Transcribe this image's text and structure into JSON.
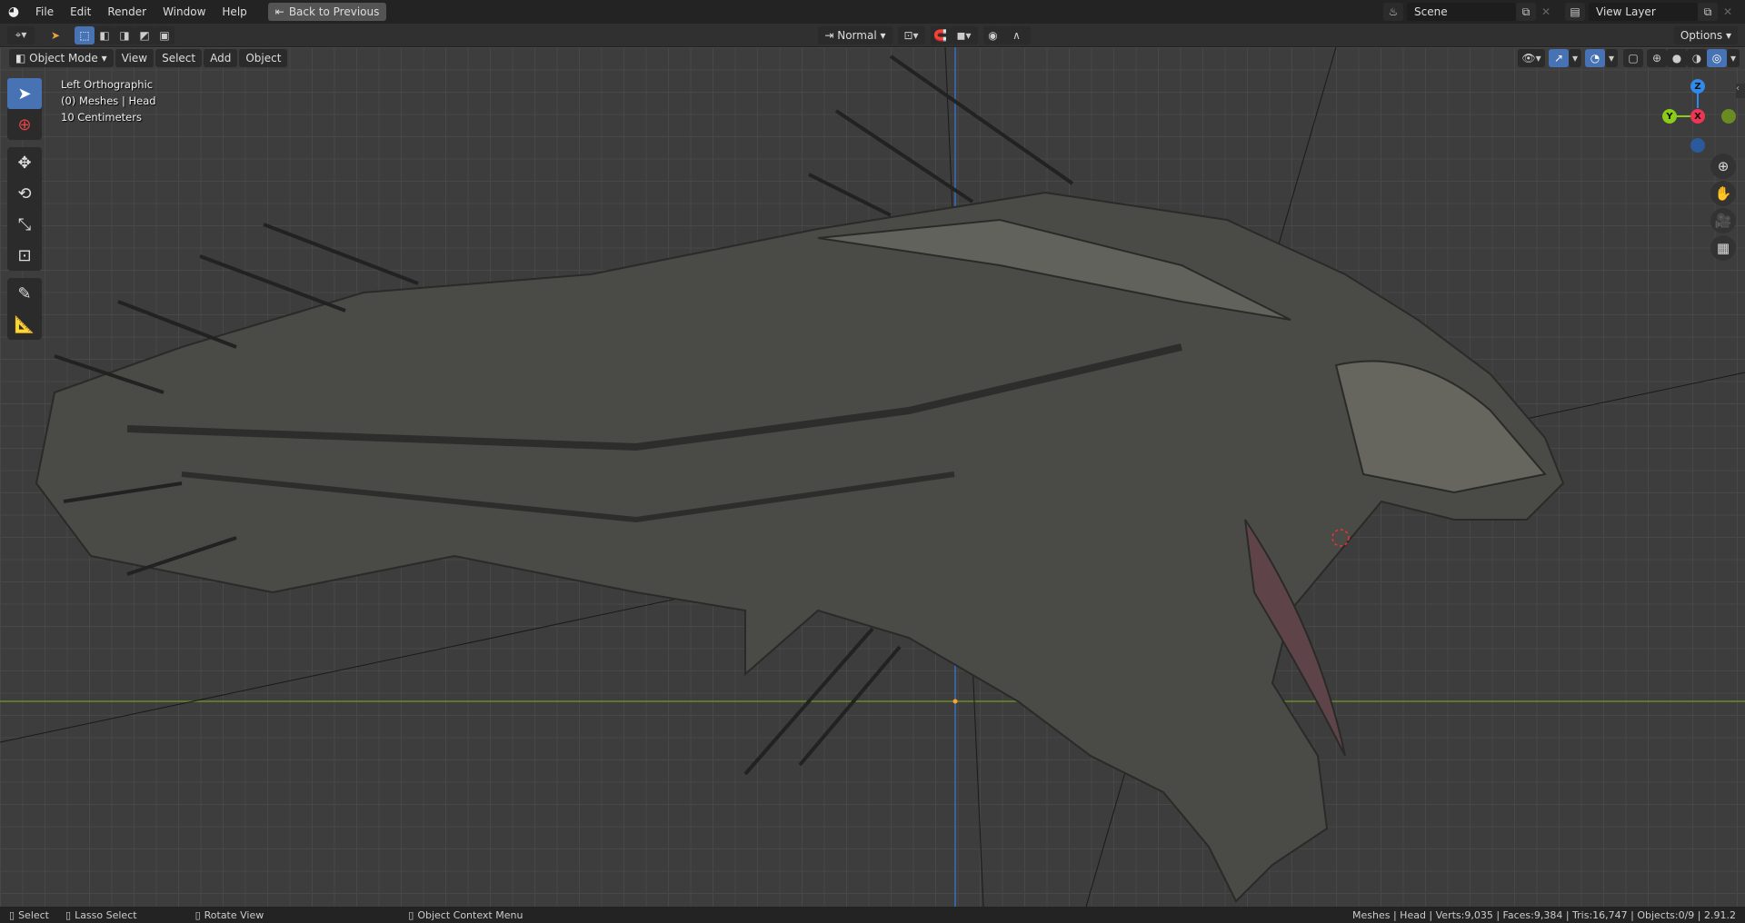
{
  "topbar": {
    "menus": [
      "File",
      "Edit",
      "Render",
      "Window",
      "Help"
    ],
    "back_button": "Back to Previous",
    "scene": "Scene",
    "view_layer": "View Layer"
  },
  "header": {
    "orientation": "Normal",
    "options": "Options"
  },
  "viewport_header": {
    "mode": "Object Mode",
    "menus": [
      "View",
      "Select",
      "Add",
      "Object"
    ]
  },
  "overlay": {
    "view": "Left Orthographic",
    "collection": "(0) Meshes | Head",
    "scale": "10 Centimeters"
  },
  "gizmo": {
    "x": "X",
    "y": "Y",
    "z": "Z"
  },
  "statusbar": {
    "select": "Select",
    "lasso": "Lasso Select",
    "rotate": "Rotate View",
    "context": "Object Context Menu",
    "stats": "Meshes | Head | Verts:9,035 | Faces:9,384 | Tris:16,747 | Objects:0/9 | 2.91.2"
  },
  "colors": {
    "accent": "#4772b3",
    "x_axis": "#ee3554",
    "y_axis": "#8bcc1a",
    "z_axis": "#2f8aeb"
  }
}
